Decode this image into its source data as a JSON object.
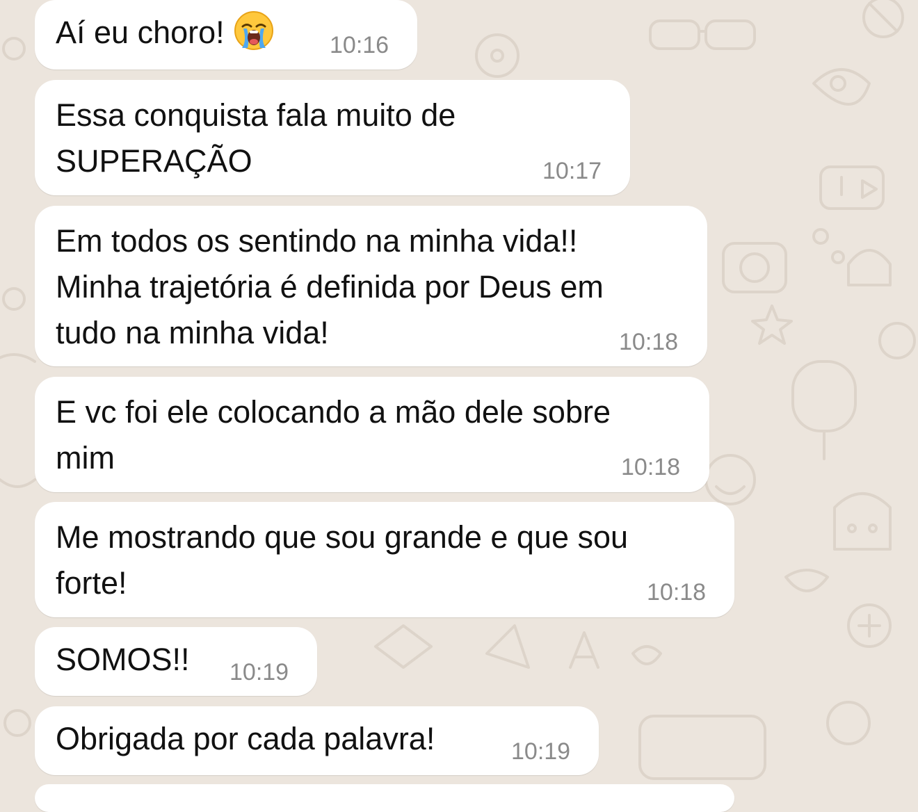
{
  "messages": [
    {
      "text": "Aí eu choro!",
      "time": "10:16",
      "emoji": "loudly-crying-face"
    },
    {
      "text": "Essa conquista fala muito de\nSUPERAÇÃO",
      "time": "10:17"
    },
    {
      "text": "Em todos os sentindo na minha vida!!\nMinha trajetória é definida por Deus em\ntudo na minha vida!",
      "time": "10:18"
    },
    {
      "text": "E vc foi ele colocando a mão dele sobre\nmim",
      "time": "10:18"
    },
    {
      "text": "Me mostrando que sou grande e que sou\nforte!",
      "time": "10:18"
    },
    {
      "text": "SOMOS!!",
      "time": "10:19"
    },
    {
      "text": "Obrigada por cada palavra!",
      "time": "10:19"
    }
  ],
  "colors": {
    "background": "#ECE5DD",
    "bubble": "#FFFFFF",
    "text": "#111111",
    "time": "#8A8A8A"
  }
}
